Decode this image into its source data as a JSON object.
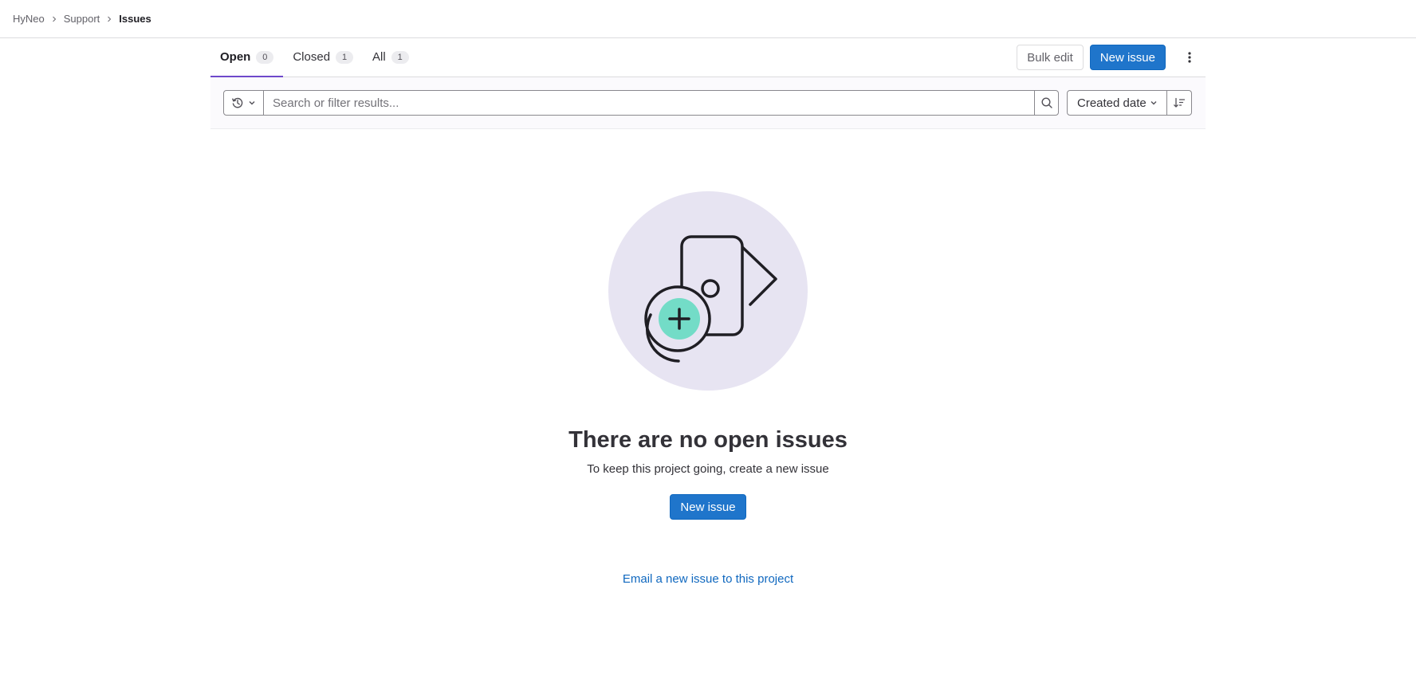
{
  "breadcrumb": {
    "items": [
      {
        "label": "HyNeo"
      },
      {
        "label": "Support"
      },
      {
        "label": "Issues"
      }
    ]
  },
  "tabs": [
    {
      "label": "Open",
      "count": "0",
      "active": true
    },
    {
      "label": "Closed",
      "count": "1",
      "active": false
    },
    {
      "label": "All",
      "count": "1",
      "active": false
    }
  ],
  "actions": {
    "bulk_edit_label": "Bulk edit",
    "new_issue_label": "New issue"
  },
  "filter": {
    "search_placeholder": "Search or filter results...",
    "sort_label": "Created date"
  },
  "empty_state": {
    "title": "There are no open issues",
    "description": "To keep this project going, create a new issue",
    "button_label": "New issue",
    "email_link": "Email a new issue to this project"
  },
  "colors": {
    "primary": "#1f75cb",
    "tab_active_underline": "#6e49cb",
    "illustration_bg": "#e7e4f2",
    "illustration_accent": "#73dcc7",
    "link": "#1068bf"
  },
  "icons": [
    "chevron-right-icon",
    "history-icon",
    "chevron-down-icon",
    "search-icon",
    "sort-icon",
    "kebab-icon"
  ]
}
